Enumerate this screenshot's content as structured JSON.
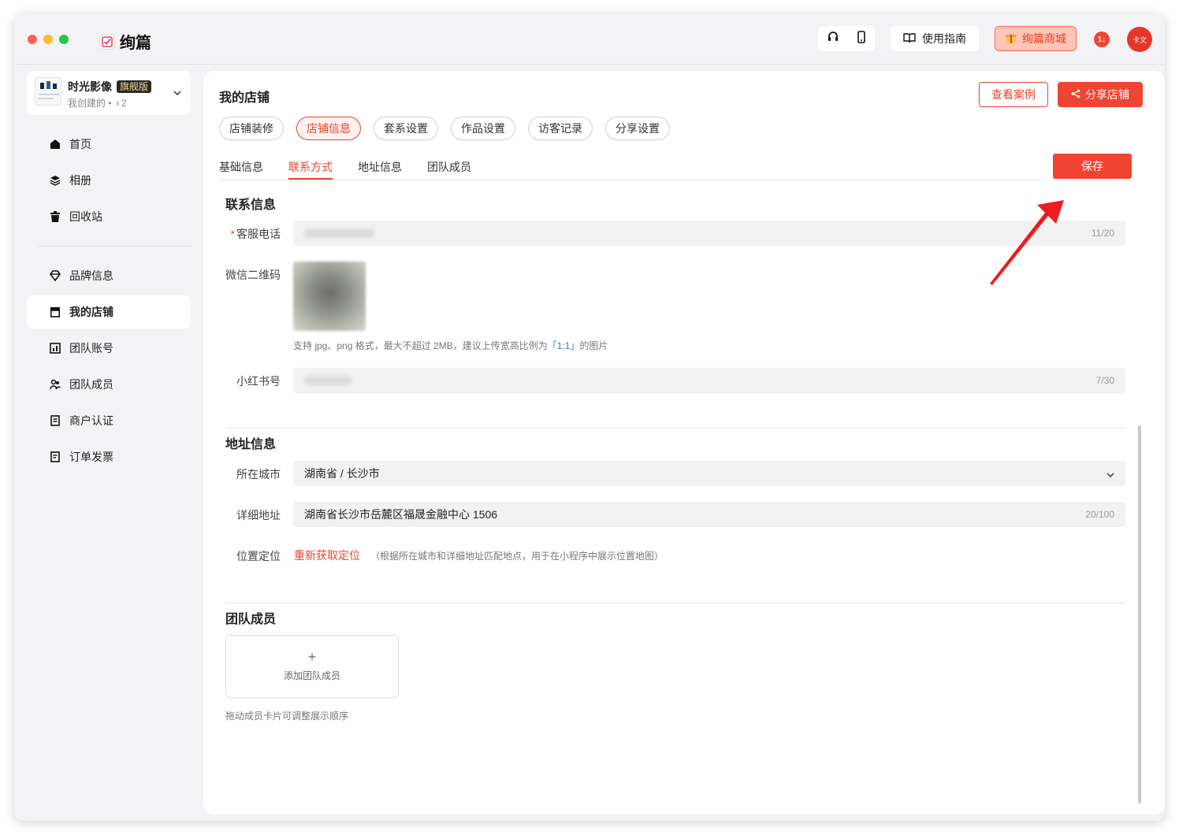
{
  "app": {
    "name": "绚篇"
  },
  "topbar": {
    "guide_label": "使用指南",
    "mall_label": "绚篇商城",
    "badge_text": "1↓",
    "avatar_text": "卡文",
    "icons": [
      "headset-icon",
      "phone-icon",
      "book-icon",
      "gift-icon"
    ]
  },
  "workspace": {
    "name": "时光影像",
    "tag": "旗舰版",
    "sub": "我创建的 • ♁2"
  },
  "sidebar": {
    "items": [
      {
        "label": "首页",
        "icon": "home-icon"
      },
      {
        "label": "相册",
        "icon": "layers-icon"
      },
      {
        "label": "回收站",
        "icon": "trash-icon"
      },
      {
        "label": "品牌信息",
        "icon": "gem-icon"
      },
      {
        "label": "我的店铺",
        "icon": "store-icon",
        "active": true
      },
      {
        "label": "团队账号",
        "icon": "chart-icon"
      },
      {
        "label": "团队成员",
        "icon": "users-icon"
      },
      {
        "label": "商户认证",
        "icon": "doc-icon"
      },
      {
        "label": "订单发票",
        "icon": "invoice-icon"
      }
    ]
  },
  "main": {
    "title": "我的店铺",
    "view_cases_label": "查看案例",
    "share_label": "分享店铺",
    "pills": [
      "店铺装修",
      "店铺信息",
      "套系设置",
      "作品设置",
      "访客记录",
      "分享设置"
    ],
    "active_pill": 1,
    "subtabs": [
      "基础信息",
      "联系方式",
      "地址信息",
      "团队成员"
    ],
    "active_subtab": 1,
    "save_label": "保存"
  },
  "contact": {
    "title": "联系信息",
    "phone_label": "客服电话",
    "phone_count": "11/20",
    "wechat_label": "微信二维码",
    "wechat_hint_prefix": "支持 jpg、png 格式，最大不超过 2MB，建议上传宽高比例为",
    "wechat_hint_ratio": "「1:1」",
    "wechat_hint_suffix": "的图片",
    "xhs_label": "小红书号",
    "xhs_count": "7/30"
  },
  "address": {
    "title": "地址信息",
    "city_label": "所在城市",
    "city_value": "湖南省 / 长沙市",
    "detail_label": "详细地址",
    "detail_value": "湖南省长沙市岳麓区福晟金融中心 1506",
    "detail_count": "20/100",
    "locate_label": "位置定位",
    "locate_link": "重新获取定位",
    "locate_hint": "（根据所在城市和详细地址匹配地点，用于在小程序中展示位置地图）"
  },
  "team": {
    "title": "团队成员",
    "add_plus": "+",
    "add_label": "添加团队成员",
    "hint": "拖动成员卡片可调整展示顺序"
  },
  "colors": {
    "accent": "#f04432",
    "annotation_arrow": "#ee1c1c"
  }
}
